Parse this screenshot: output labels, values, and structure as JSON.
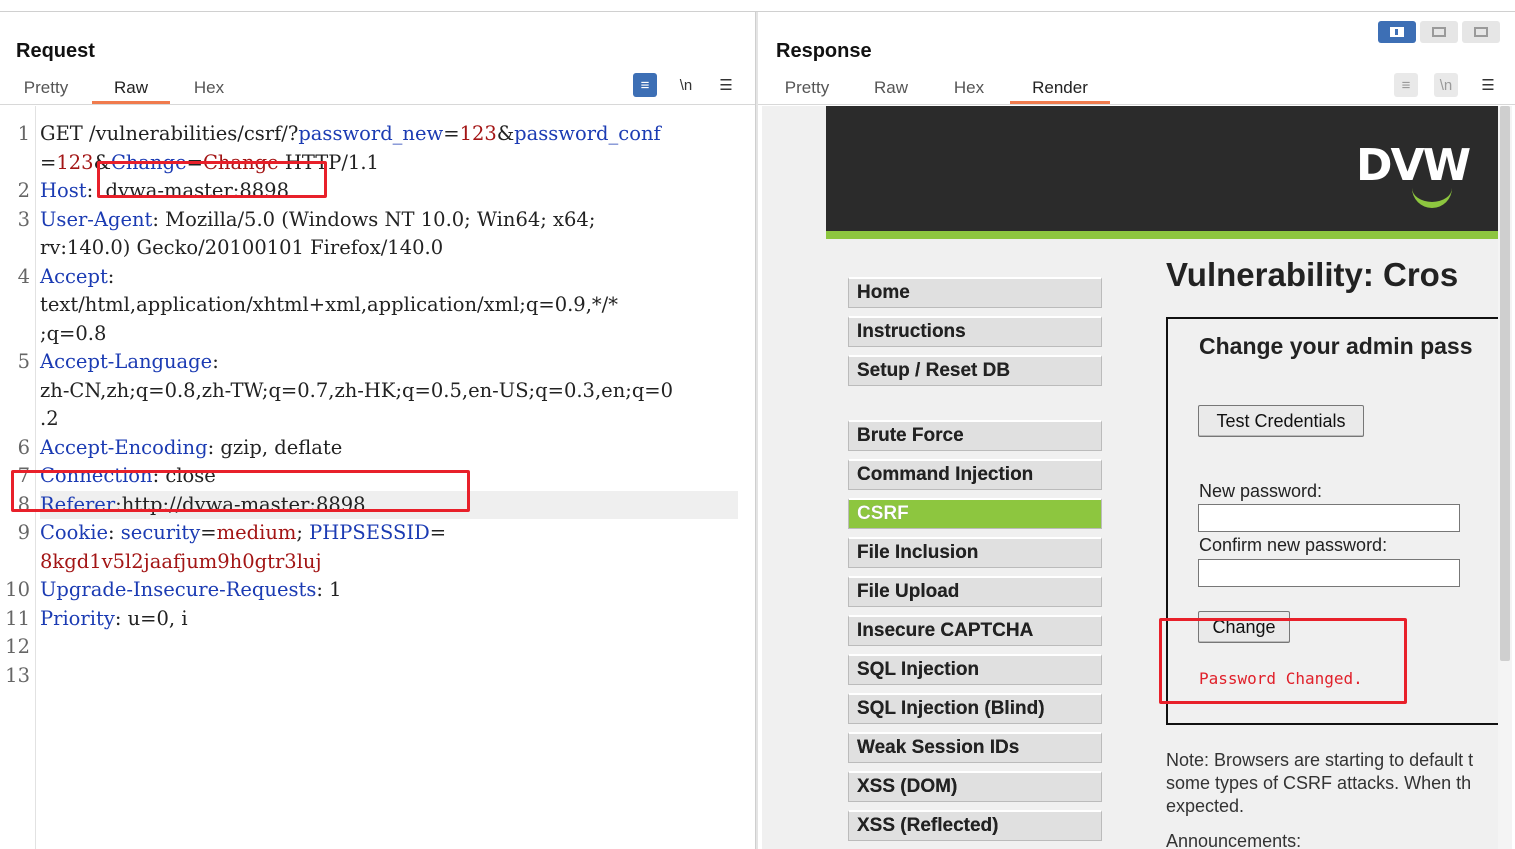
{
  "request": {
    "title": "Request",
    "tabs": [
      "Pretty",
      "Raw",
      "Hex"
    ],
    "active_tab": "Raw",
    "tools": {
      "wrap": "≡",
      "newline": "\\n",
      "menu": "☰"
    },
    "lines": [
      {
        "n": "1",
        "parts": [
          [
            "p",
            "GET /vulnerabilities/csrf/?"
          ],
          [
            "k",
            "password_new"
          ],
          [
            "p",
            "="
          ],
          [
            "v",
            "123"
          ],
          [
            "p",
            "&"
          ],
          [
            "k",
            "password_conf"
          ]
        ]
      },
      {
        "n": "",
        "parts": [
          [
            "p",
            "="
          ],
          [
            "v",
            "123"
          ],
          [
            "p",
            "&"
          ],
          [
            "k",
            "Change"
          ],
          [
            "p",
            "="
          ],
          [
            "v",
            "Change"
          ],
          [
            "p",
            " HTTP/1.1"
          ]
        ]
      },
      {
        "n": "2",
        "parts": [
          [
            "k",
            "Host"
          ],
          [
            "p",
            ":  dvwa-master:8898"
          ]
        ]
      },
      {
        "n": "3",
        "parts": [
          [
            "k",
            "User-Agent"
          ],
          [
            "p",
            ": Mozilla/5.0 (Windows NT 10.0; Win64; x64;"
          ]
        ]
      },
      {
        "n": "",
        "parts": [
          [
            "p",
            "rv:140.0) Gecko/20100101 Firefox/140.0"
          ]
        ]
      },
      {
        "n": "4",
        "parts": [
          [
            "k",
            "Accept"
          ],
          [
            "p",
            ":"
          ]
        ]
      },
      {
        "n": "",
        "parts": [
          [
            "p",
            "text/html,application/xhtml+xml,application/xml;q=0.9,*/*"
          ]
        ]
      },
      {
        "n": "",
        "parts": [
          [
            "p",
            ";q=0.8"
          ]
        ]
      },
      {
        "n": "5",
        "parts": [
          [
            "k",
            "Accept-Language"
          ],
          [
            "p",
            ":"
          ]
        ]
      },
      {
        "n": "",
        "parts": [
          [
            "p",
            "zh-CN,zh;q=0.8,zh-TW;q=0.7,zh-HK;q=0.5,en-US;q=0.3,en;q=0"
          ]
        ]
      },
      {
        "n": "",
        "parts": [
          [
            "p",
            ".2"
          ]
        ]
      },
      {
        "n": "6",
        "parts": [
          [
            "k",
            "Accept-Encoding"
          ],
          [
            "p",
            ": gzip, deflate"
          ]
        ]
      },
      {
        "n": "7",
        "parts": [
          [
            "k",
            "Connection"
          ],
          [
            "p",
            ": close"
          ]
        ]
      },
      {
        "n": "8",
        "parts": [
          [
            "k",
            "Referer"
          ],
          [
            "p",
            ":http://dvwa-master:8898"
          ]
        ]
      },
      {
        "n": "9",
        "parts": [
          [
            "k",
            "Cookie"
          ],
          [
            "p",
            ": "
          ],
          [
            "k",
            "security"
          ],
          [
            "p",
            "="
          ],
          [
            "v",
            "medium"
          ],
          [
            "p",
            "; "
          ],
          [
            "k",
            "PHPSESSID"
          ],
          [
            "p",
            "="
          ]
        ]
      },
      {
        "n": "",
        "parts": [
          [
            "v",
            "8kgd1v5l2jaafjum9h0gtr3luj"
          ]
        ]
      },
      {
        "n": "10",
        "parts": [
          [
            "k",
            "Upgrade-Insecure-Requests"
          ],
          [
            "p",
            ": 1"
          ]
        ]
      },
      {
        "n": "11",
        "parts": [
          [
            "k",
            "Priority"
          ],
          [
            "p",
            ": u=0, i"
          ]
        ]
      },
      {
        "n": "12",
        "parts": []
      },
      {
        "n": "13",
        "parts": []
      }
    ]
  },
  "response": {
    "title": "Response",
    "tabs": [
      "Pretty",
      "Raw",
      "Hex",
      "Render"
    ],
    "active_tab": "Render",
    "render": {
      "logo": "DVW",
      "heading": "Vulnerability: Cros",
      "menu_group1": [
        "Home",
        "Instructions",
        "Setup / Reset DB"
      ],
      "menu_group2": [
        "Brute Force",
        "Command Injection",
        "CSRF",
        "File Inclusion",
        "File Upload",
        "Insecure CAPTCHA",
        "SQL Injection",
        "SQL Injection (Blind)",
        "Weak Session IDs",
        "XSS (DOM)",
        "XSS (Reflected)"
      ],
      "selected_menu": "CSRF",
      "box_title": "Change your admin pass",
      "test_button": "Test Credentials",
      "new_password_label": "New password:",
      "confirm_password_label": "Confirm new password:",
      "change_button": "Change",
      "result": "Password Changed.",
      "note": "Note: Browsers are starting to default t some types of CSRF attacks. When th expected.",
      "announcements": "Announcements:"
    }
  },
  "colors": {
    "accent": "#3d6fb5",
    "tab_underline": "#f07b4d",
    "header_key": "#1b3bb3",
    "value": "#a31515",
    "annotation": "#e8202a",
    "dvwa_green": "#8dc63f"
  }
}
